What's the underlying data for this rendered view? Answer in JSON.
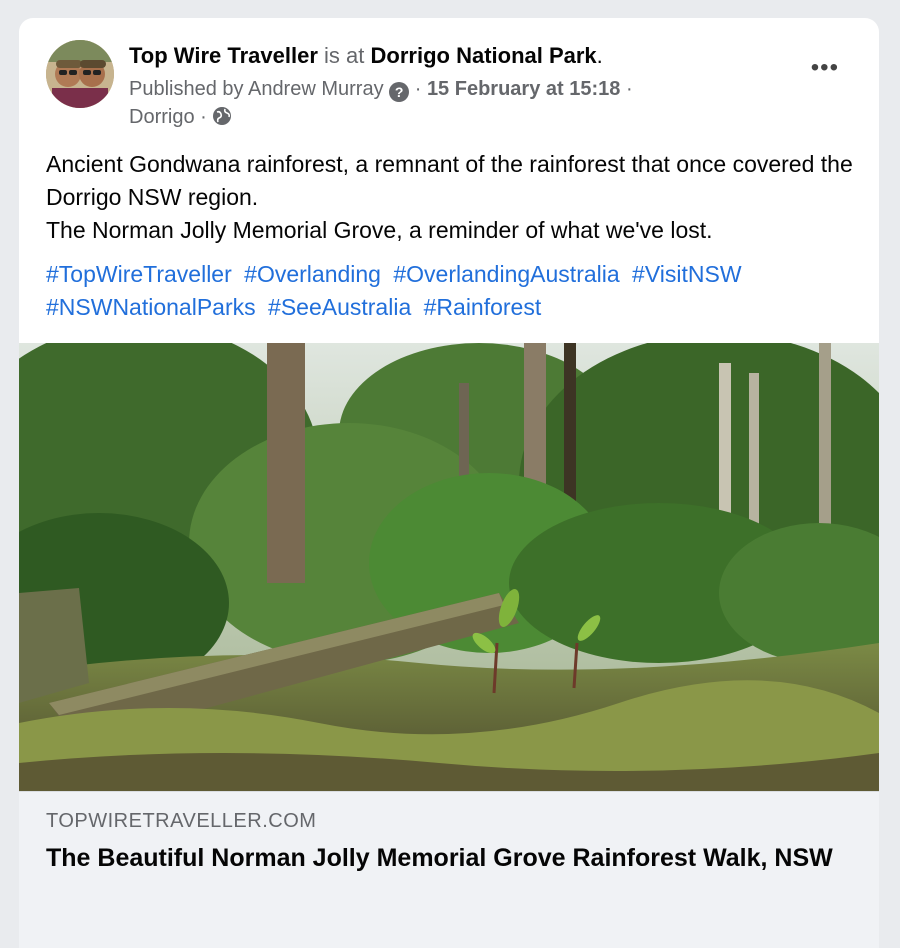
{
  "post": {
    "page_name": "Top Wire Traveller",
    "is_at": "is at",
    "place": "Dorrigo National Park",
    "period": ".",
    "published_by": "Published by Andrew Murray",
    "sep1": "·",
    "date": "15 February at 15:18",
    "sep2": "·",
    "location": "Dorrigo",
    "sep3": "·",
    "more_label": "•••",
    "body_lines": [
      "Ancient Gondwana rainforest, a remnant of the rainforest that once covered the Dorrigo NSW region.",
      "The Norman Jolly Memorial Grove, a reminder of what we've lost."
    ],
    "hashtags": [
      "#TopWireTraveller",
      "#Overlanding",
      "#OverlandingAustralia",
      "#VisitNSW",
      "#NSWNationalParks",
      "#SeeAustralia",
      "#Rainforest"
    ]
  },
  "link_preview": {
    "domain": "TOPWIRETRAVELLER.COM",
    "title": "The Beautiful Norman Jolly Memorial Grove Rainforest Walk, NSW"
  },
  "icons": {
    "help": "question-circle-icon",
    "audience": "globe-icon",
    "more": "more-horizontal-icon"
  },
  "colors": {
    "link_blue": "#216fdb",
    "muted_gray": "#65676b",
    "card_bg": "#ffffff",
    "link_box_bg": "#f0f2f5"
  }
}
